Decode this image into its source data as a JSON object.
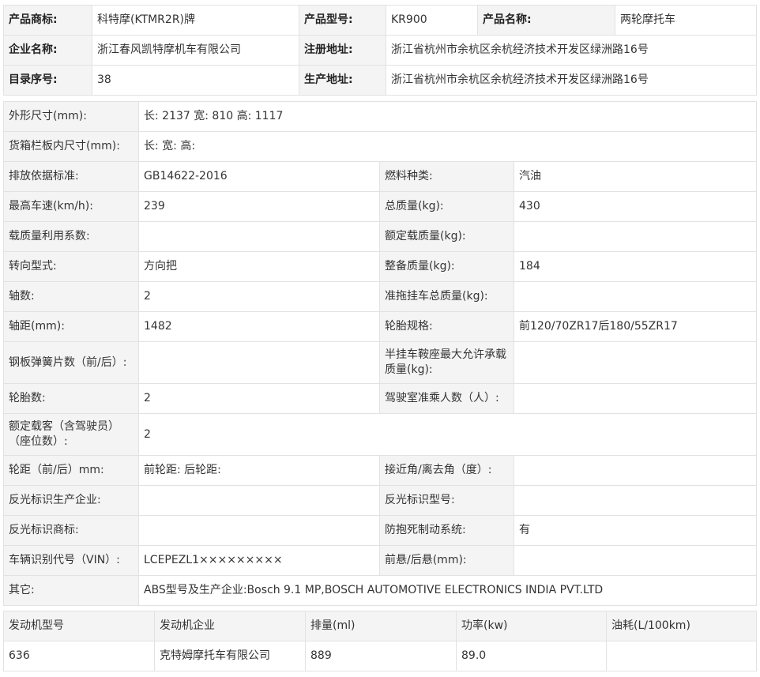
{
  "header": {
    "brand_label": "产品商标:",
    "brand": "科特摩(KTMR2R)牌",
    "model_label": "产品型号:",
    "model": "KR900",
    "name_label": "产品名称:",
    "name": "两轮摩托车",
    "company_label": "企业名称:",
    "company": "浙江春风凯特摩机车有限公司",
    "reg_addr_label": "注册地址:",
    "reg_addr": "浙江省杭州市余杭区余杭经济技术开发区绿洲路16号",
    "catalog_label": "目录序号:",
    "catalog": "38",
    "prod_addr_label": "生产地址:",
    "prod_addr": "浙江省杭州市余杭区余杭经济技术开发区绿洲路16号"
  },
  "specs": {
    "dims_label": "外形尺寸(mm):",
    "dims": "长: 2137 宽: 810 高: 1117",
    "cargo_label": "货箱栏板内尺寸(mm):",
    "cargo": "长: 宽: 高:",
    "emission_label": "排放依据标准:",
    "emission": "GB14622-2016",
    "fuel_label": "燃料种类:",
    "fuel": "汽油",
    "speed_label": "最高车速(km/h):",
    "speed": "239",
    "total_mass_label": "总质量(kg):",
    "total_mass": "430",
    "load_coef_label": "载质量利用系数:",
    "load_coef": "",
    "rated_load_label": "额定载质量(kg):",
    "rated_load": "",
    "steering_label": "转向型式:",
    "steering": "方向把",
    "curb_label": "整备质量(kg):",
    "curb": "184",
    "axles_label": "轴数:",
    "axles": "2",
    "trailer_label": "准拖挂车总质量(kg):",
    "trailer": "",
    "wheelbase_label": "轴距(mm):",
    "wheelbase": "1482",
    "tire_spec_label": "轮胎规格:",
    "tire_spec": "前120/70ZR17后180/55ZR17",
    "spring_label": "钢板弹簧片数（前/后）:",
    "spring": "",
    "saddle_label": "半挂车鞍座最大允许承载质量(kg):",
    "saddle": "",
    "tires_label": "轮胎数:",
    "tires": "2",
    "cab_label": "驾驶室准乘人数（人）:",
    "cab": "",
    "seats_label": "额定载客（含驾驶员）（座位数）:",
    "seats": "2",
    "track_label": "轮距（前/后）mm:",
    "track": "前轮距: 后轮距:",
    "angle_label": "接近角/离去角（度）:",
    "angle": "",
    "refl_maker_label": "反光标识生产企业:",
    "refl_maker": "",
    "refl_model_label": "反光标识型号:",
    "refl_model": "",
    "refl_brand_label": "反光标识商标:",
    "refl_brand": "",
    "abs_label": "防抱死制动系统:",
    "abs": "有",
    "vin_label": "车辆识别代号（VIN）:",
    "vin": "LCEPEZL1×××××××××",
    "overhang_label": "前悬/后悬(mm):",
    "overhang": "",
    "other_label": "其它:",
    "other": "ABS型号及生产企业:Bosch 9.1 MP,BOSCH AUTOMOTIVE ELECTRONICS INDIA PVT.LTD"
  },
  "engine": {
    "headers": [
      "发动机型号",
      "发动机企业",
      "排量(ml)",
      "功率(kw)",
      "油耗(L/100km)"
    ],
    "row": [
      "636",
      "克特姆摩托车有限公司",
      "889",
      "89.0",
      ""
    ]
  }
}
